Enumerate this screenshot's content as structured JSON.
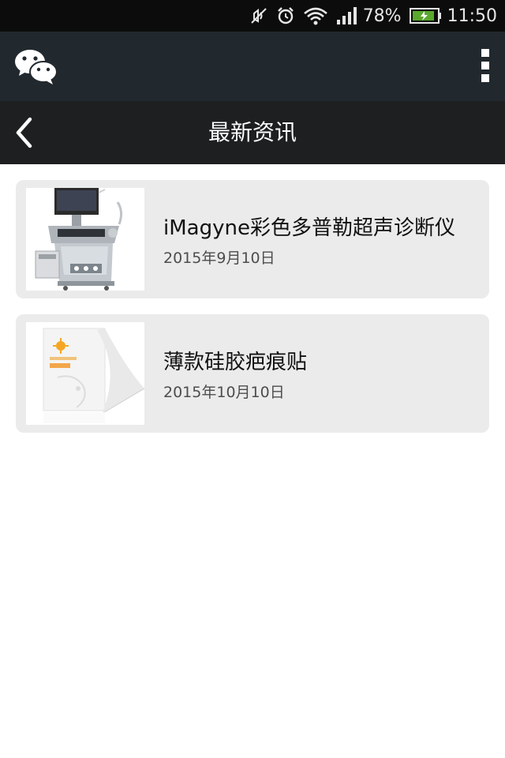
{
  "status_bar": {
    "battery": "78%",
    "time": "11:50",
    "icons": [
      "mute-icon",
      "alarm-icon",
      "wifi-icon",
      "signal-icon",
      "battery-charging-icon"
    ]
  },
  "wechat_bar": {
    "logo_icon": "wechat-logo-icon",
    "menu_icon": "more-vertical-icon"
  },
  "title_bar": {
    "back_icon": "back-chevron-icon",
    "title": "最新资讯"
  },
  "news": [
    {
      "title": "iMagyne彩色多普勒超声诊断仪",
      "date": "2015年9月10日",
      "image": "ultrasound-machine-image"
    },
    {
      "title": "薄款硅胶疤痕贴",
      "date": "2015年10月10日",
      "image": "scar-patch-package-image"
    }
  ]
}
